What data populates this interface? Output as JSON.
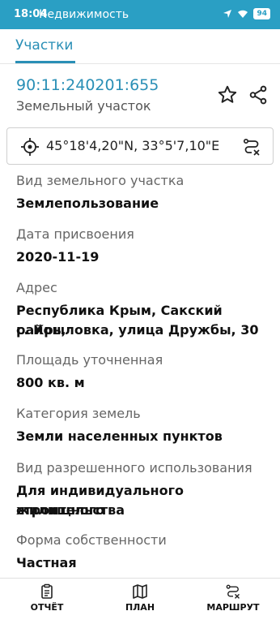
{
  "status_bar": {
    "time": "18:04",
    "app_name": "Недвижимость",
    "battery": "94"
  },
  "tabs": {
    "active": "Участки"
  },
  "parcel": {
    "cadastral_number": "90:11:240201:655",
    "object_type": "Земельный участок",
    "coordinates": "45°18'4,20\"N, 33°5'7,10\"E"
  },
  "fields": [
    {
      "label": "Вид земельного участка",
      "value": "Землепользование"
    },
    {
      "label": "Дата присвоения",
      "value": "2020-11-19"
    },
    {
      "label": "Адрес",
      "value_line1": "Республика Крым, Сакский район,",
      "value_line2": "с. Крыловка, улица Дружбы, 30"
    },
    {
      "label": "Площадь уточненная",
      "value": "800 кв. м"
    },
    {
      "label": "Категория земель",
      "value": "Земли населенных пунктов"
    },
    {
      "label": "Вид разрешенного использования",
      "value_line1": "Для индивидуального жилищного",
      "value_line2": "строительства"
    },
    {
      "label": "Форма собственности",
      "value": "Частная"
    }
  ],
  "bottom_nav": [
    {
      "label": "ОТЧЁТ",
      "icon": "report-icon"
    },
    {
      "label": "ПЛАН",
      "icon": "map-icon"
    },
    {
      "label": "МАРШРУТ",
      "icon": "route-icon"
    }
  ],
  "colors": {
    "accent": "#2a8fb6",
    "status_bar": "#2a9fc4"
  }
}
